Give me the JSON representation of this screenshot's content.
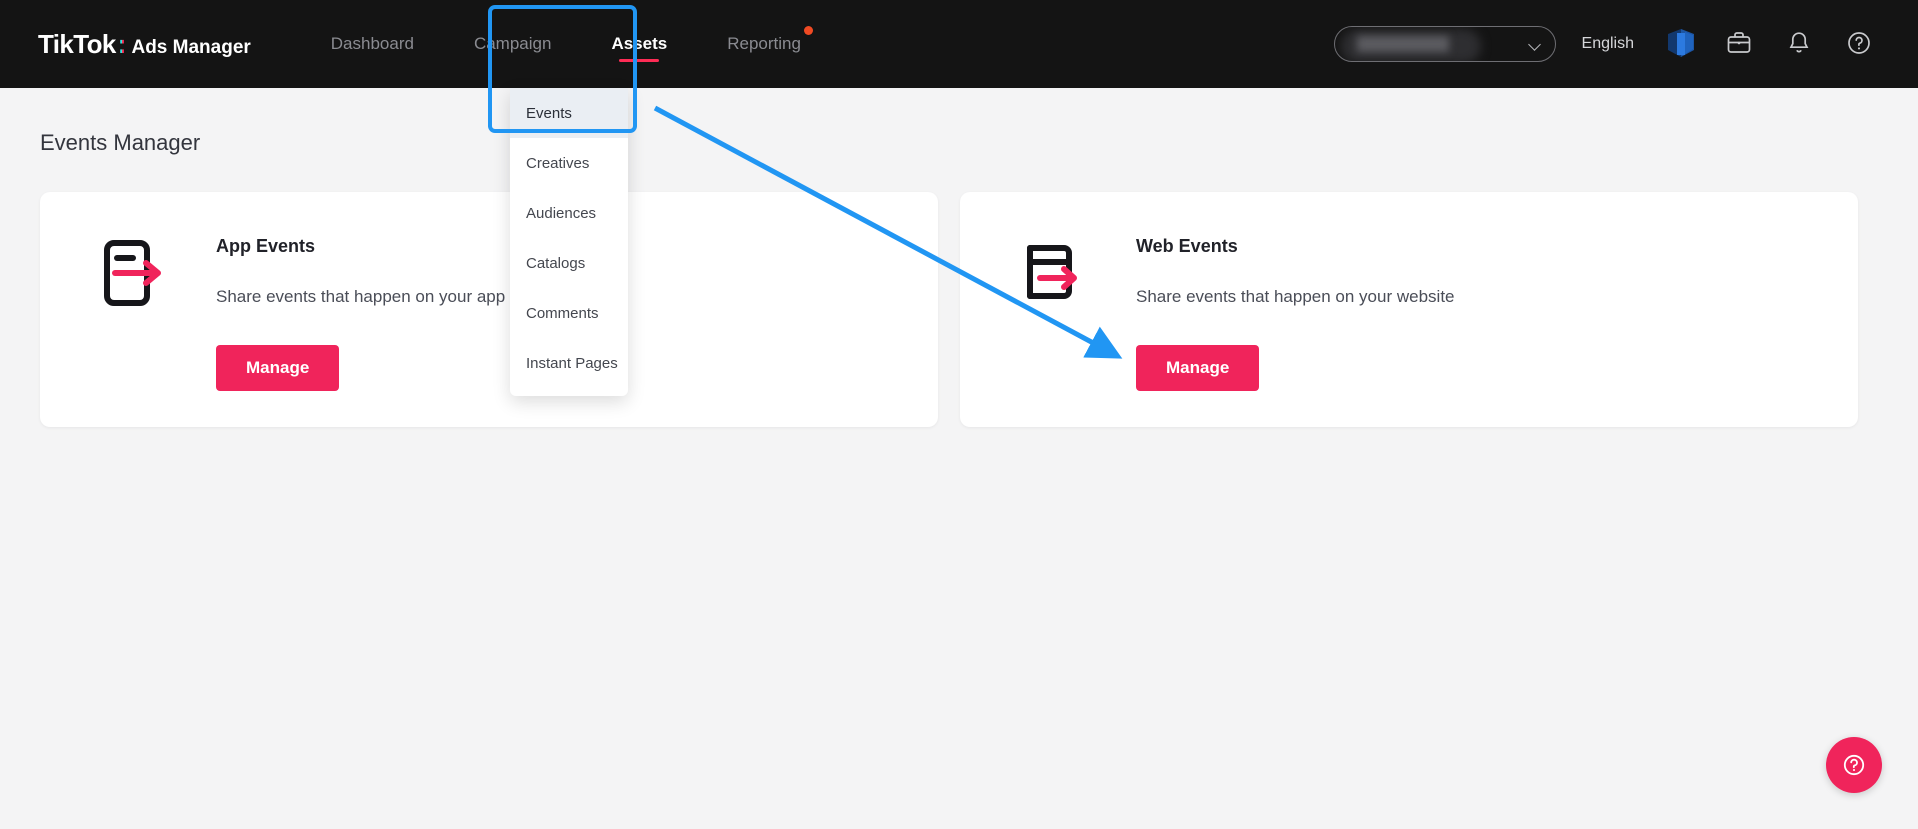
{
  "brand": {
    "name": "TikTok",
    "colon": ":",
    "product": "Ads Manager"
  },
  "nav": {
    "items": [
      {
        "label": "Dashboard",
        "active": false,
        "badge": false
      },
      {
        "label": "Campaign",
        "active": false,
        "badge": false
      },
      {
        "label": "Assets",
        "active": true,
        "badge": false
      },
      {
        "label": "Reporting",
        "active": false,
        "badge": true
      }
    ]
  },
  "topright": {
    "account_value": "",
    "account_redacted": true,
    "chevron_icon": "chevron-down-icon",
    "language": "English",
    "icons": [
      "tiktok-business-cube-icon",
      "briefcase-icon",
      "bell-icon",
      "help-circle-icon"
    ]
  },
  "dropdown": {
    "items": [
      {
        "label": "Events",
        "selected": true
      },
      {
        "label": "Creatives",
        "selected": false
      },
      {
        "label": "Audiences",
        "selected": false
      },
      {
        "label": "Catalogs",
        "selected": false
      },
      {
        "label": "Comments",
        "selected": false
      },
      {
        "label": "Instant Pages",
        "selected": false
      }
    ]
  },
  "page": {
    "title": "Events Manager"
  },
  "cards": [
    {
      "icon": "app-events-icon",
      "title": "App Events",
      "description": "Share events that happen on your app",
      "button": "Manage"
    },
    {
      "icon": "web-events-icon",
      "title": "Web Events",
      "description": "Share events that happen on your website",
      "button": "Manage"
    }
  ],
  "help_fab": {
    "icon": "help-circle-icon"
  },
  "colors": {
    "brand_pink": "#fe2c55",
    "button_pink": "#f0245b",
    "annotation_blue": "#2196f3",
    "badge_orange": "#f04a23",
    "topbar_bg": "#141414",
    "page_bg": "#f4f4f5",
    "menu_selected_bg": "#eaeef3"
  }
}
